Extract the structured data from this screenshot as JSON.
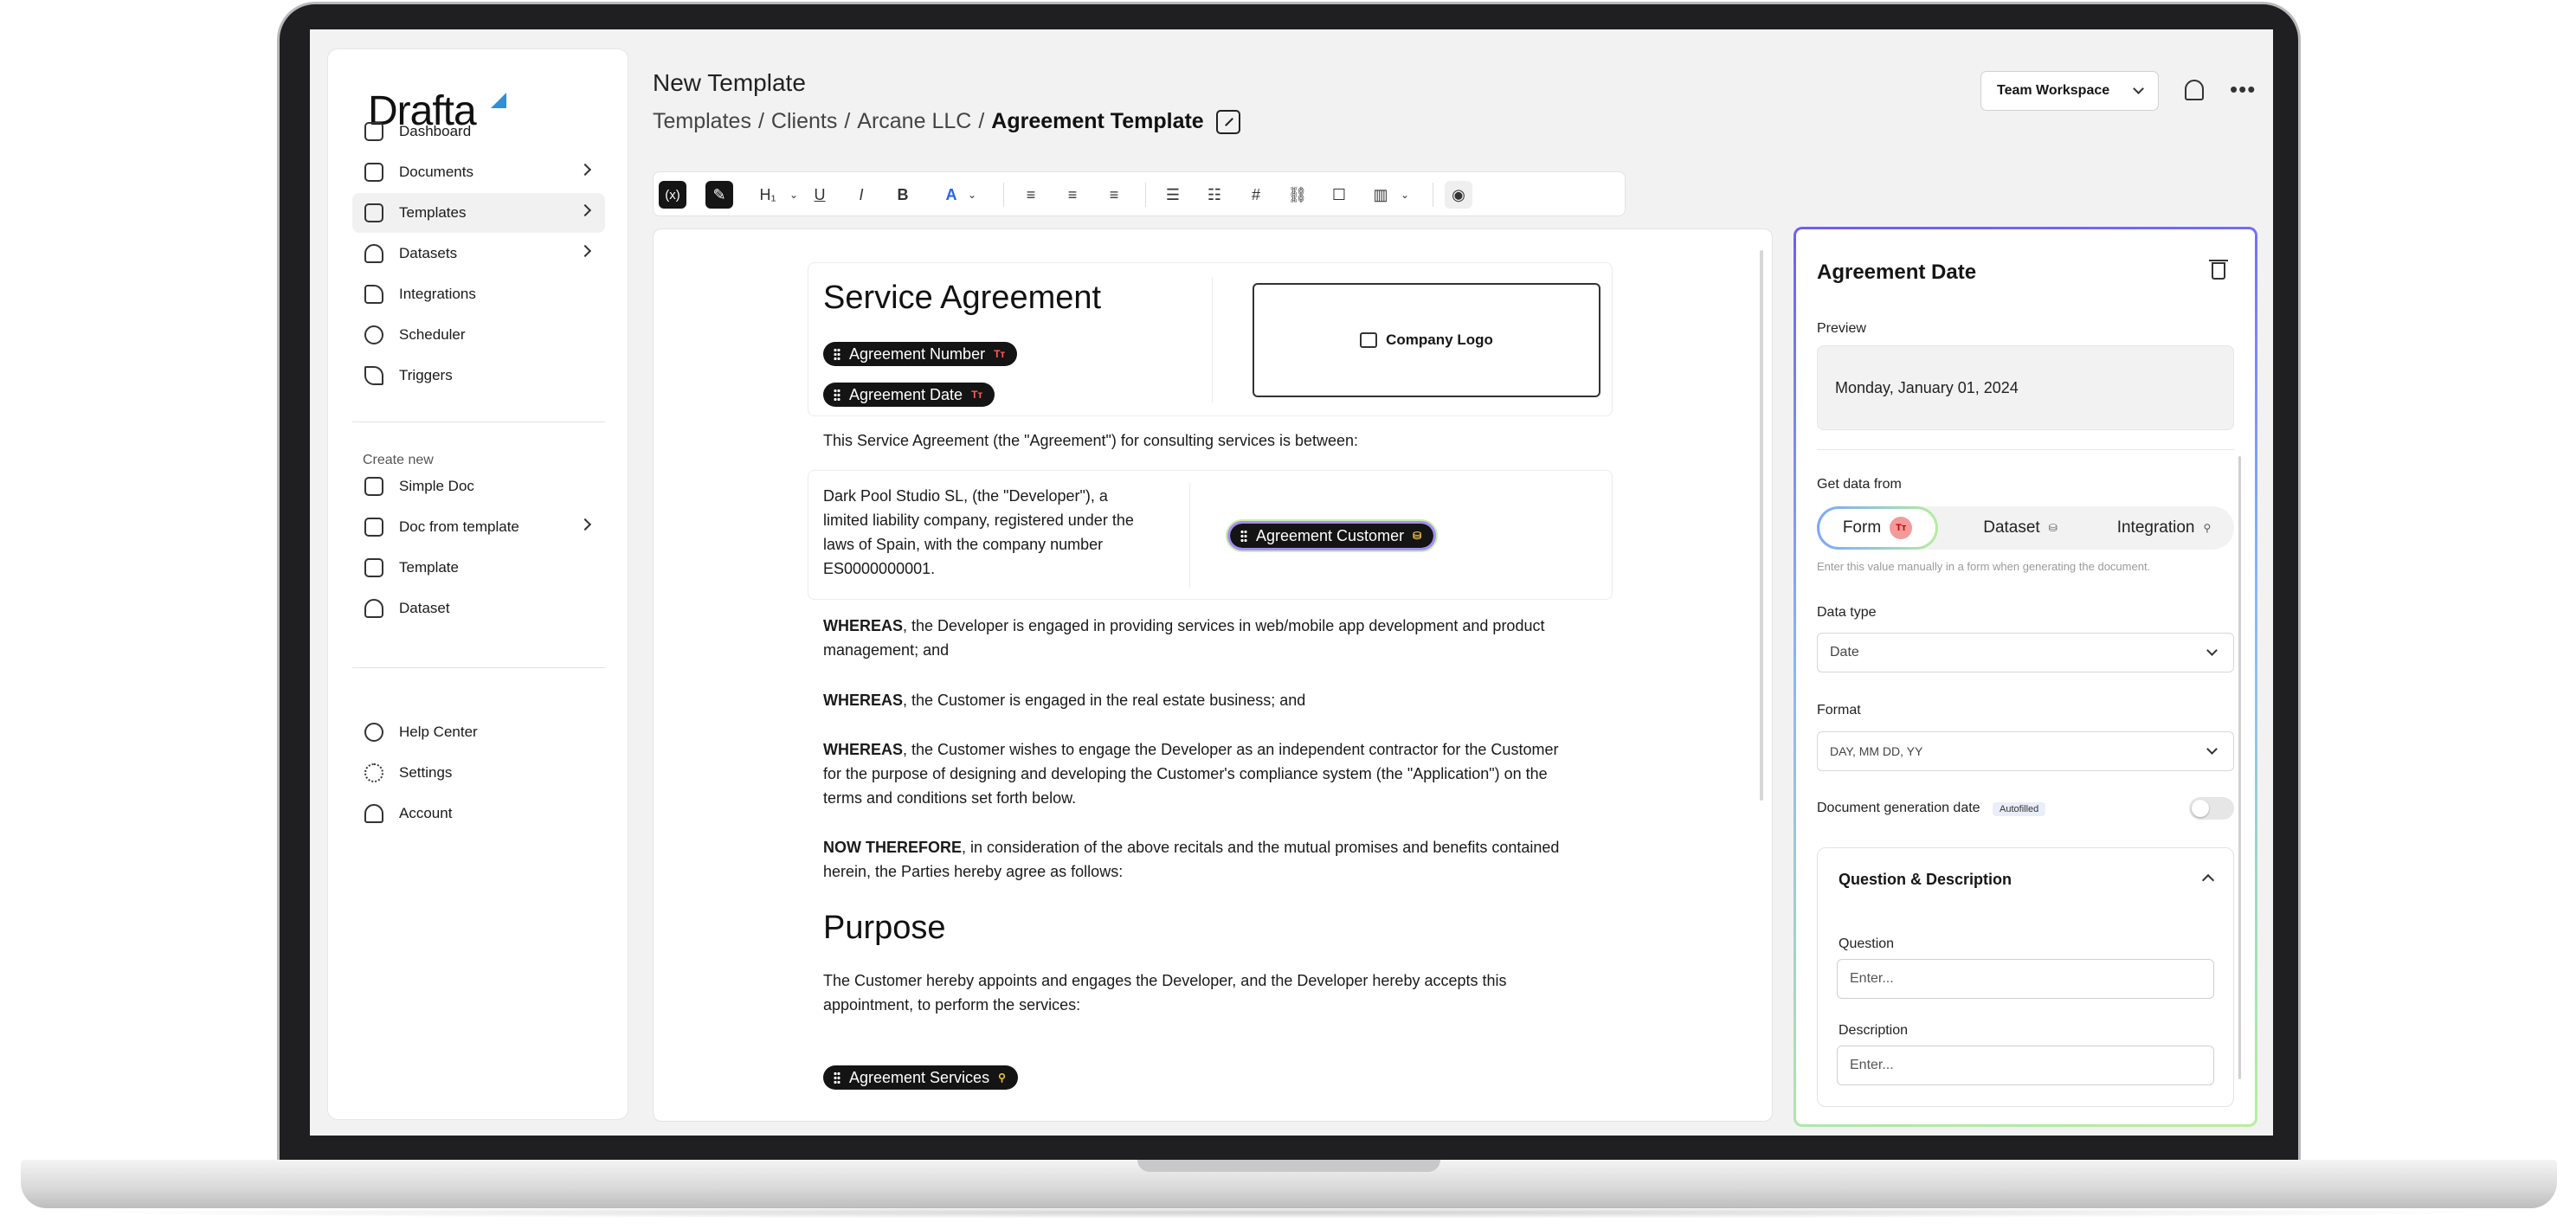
{
  "sidebar": {
    "logo": "Drafta",
    "items": [
      {
        "label": "Dashboard"
      },
      {
        "label": "Documents"
      },
      {
        "label": "Templates"
      },
      {
        "label": "Datasets"
      },
      {
        "label": "Integrations"
      },
      {
        "label": "Scheduler"
      },
      {
        "label": "Triggers"
      }
    ],
    "create_label": "Create new",
    "create_items": [
      {
        "label": "Simple Doc"
      },
      {
        "label": "Doc from template"
      },
      {
        "label": "Template"
      },
      {
        "label": "Dataset"
      }
    ],
    "footer_items": [
      {
        "label": "Help Center"
      },
      {
        "label": "Settings"
      },
      {
        "label": "Account"
      }
    ]
  },
  "header": {
    "title": "New Template",
    "breadcrumb": [
      "Templates",
      "Clients",
      "Arcane LLC"
    ],
    "breadcrumb_sep": "/",
    "current": "Agreement Template",
    "workspace": "Team Workspace"
  },
  "toolbar": {
    "variable": "(x)",
    "magic": "✎",
    "heading": "H₁",
    "underline": "U",
    "italic": "I",
    "bold": "B",
    "color": "A",
    "caret": "⌄"
  },
  "document": {
    "title": "Service Agreement",
    "tags": {
      "number": "Agreement Number",
      "date": "Agreement Date",
      "customer": "Agreement Customer",
      "services": "Agreement Services",
      "text_type": "Tт"
    },
    "logo_label": "Company Logo",
    "intro": "This Service Agreement (the \"Agreement\") for consulting services is between:",
    "party": "Dark Pool Studio SL, (the \"Developer\"), a limited liability company, registered under the laws of Spain, with the company number ES0000000001.",
    "whereas_kw": "WHEREAS",
    "whereas1": ", the Developer is engaged in providing services in web/mobile app development and product management; and",
    "whereas2": ", the Customer is engaged in the real estate business; and",
    "whereas3": ", the Customer wishes to engage the Developer as an independent contractor for the Customer for the purpose of designing and developing the Customer's compliance system (the \"Application\") on the terms and conditions set forth below.",
    "now_kw": "NOW THEREFORE",
    "now_text": ", in consideration of the above recitals and the mutual promises and benefits contained herein, the Parties hereby agree as follows:",
    "purpose_heading": "Purpose",
    "purpose_text": "The Customer hereby appoints and engages the Developer, and the Developer hereby accepts this appointment, to perform the services:"
  },
  "panel": {
    "title": "Agreement Date",
    "preview_label": "Preview",
    "preview_value": "Monday, January 01, 2024",
    "source_label": "Get data from",
    "sources": [
      "Form",
      "Dataset",
      "Integration"
    ],
    "source_selected": "Form",
    "hint": "Enter this value manually in a form when generating the document.",
    "data_type_label": "Data type",
    "data_type_value": "Date",
    "format_label": "Format",
    "format_value": "DAY, MM DD, YY",
    "gen_date_label": "Document generation date",
    "autofilled": "Autofilled",
    "qd_title": "Question & Description",
    "question_label": "Question",
    "question_placeholder": "Enter...",
    "description_label": "Description",
    "description_placeholder": "Enter..."
  },
  "colors": {
    "accent_blue": "#2563eb",
    "panel_gradient_start": "#6d5ef6",
    "panel_gradient_end": "#b5f09b",
    "tag_red": "#ff5a5a"
  }
}
